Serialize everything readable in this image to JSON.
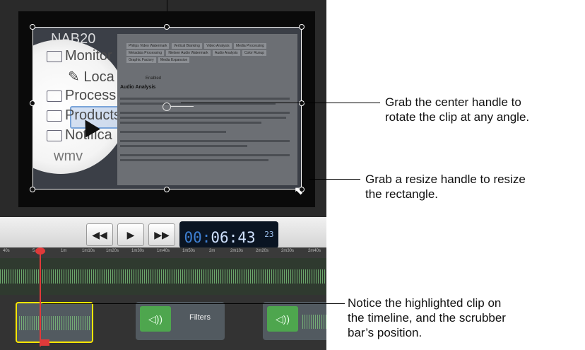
{
  "viewer": {
    "tree_items": [
      "NAB20",
      "Monitor",
      "Loca",
      "Process",
      "Products",
      "Notifica",
      "wmv"
    ],
    "doc_tabs": [
      "Philips Video Watermark",
      "Vertical Blanking",
      "Video Analysis",
      "Media Processing",
      "Metadata Processing",
      "Nielsen Audio Watermark",
      "Audio Analysis",
      "Color Runup",
      "Graphic Factory",
      "Media Expansion"
    ],
    "doc_enabled": "Enabled",
    "doc_title": "Audio Analysis"
  },
  "transport": {
    "rewind_icon": "rewind-icon",
    "play_icon": "play-icon",
    "forward_icon": "fast-forward-icon",
    "timecode_dim": "00:",
    "timecode_main": "06:43",
    "timecode_frames": "23"
  },
  "ruler": {
    "ticks": [
      "40s",
      "5",
      "1m",
      "1m10s",
      "1m20s",
      "1m30s",
      "1m40s",
      "1m50s",
      "2m",
      "2m10s",
      "2m20s",
      "2m30s",
      "2m40s"
    ]
  },
  "clips": {
    "filter_label": "Filters",
    "speaker_icon": "speaker-icon"
  },
  "callouts": {
    "rotate_line1": "Grab the center handle to",
    "rotate_line2": "rotate the clip at any angle.",
    "resize_line1": "Grab a resize handle to resize",
    "resize_line2": "the rectangle.",
    "notice_line1": "Notice the highlighted clip on",
    "notice_line2": "the timeline, and the scrubber",
    "notice_line3": "bar’s position."
  },
  "colors": {
    "accent_yellow": "#ffe600",
    "scrubber_red": "#e03a3a",
    "clip_green": "#4ea64e",
    "timecode_blue": "#3e7fd2"
  }
}
